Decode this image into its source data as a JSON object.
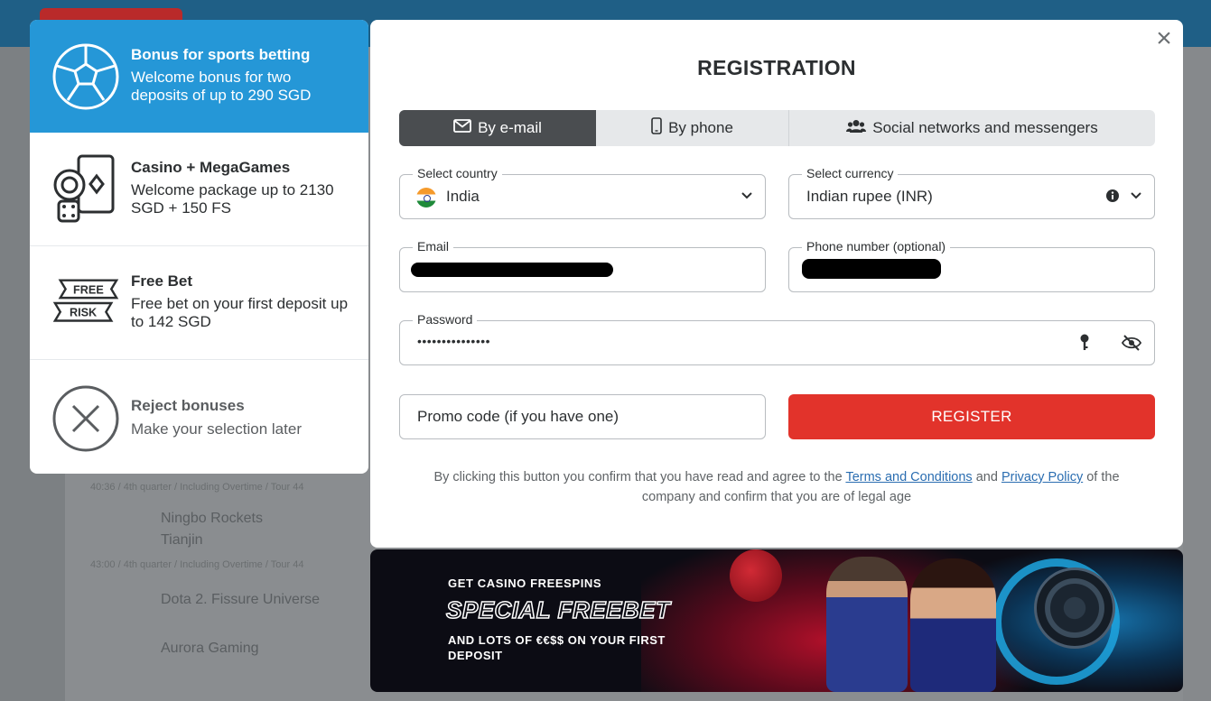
{
  "modal": {
    "title": "REGISTRATION",
    "close_label": "×"
  },
  "tabs": [
    {
      "label": "By e-mail",
      "icon": "envelope-icon",
      "active": true
    },
    {
      "label": "By phone",
      "icon": "phone-icon",
      "active": false
    },
    {
      "label": "Social networks and messengers",
      "icon": "users-icon",
      "active": false
    }
  ],
  "form": {
    "country": {
      "label": "Select country",
      "value": "India",
      "icon": "india-flag-icon"
    },
    "currency": {
      "label": "Select currency",
      "value": "Indian rupee (INR)"
    },
    "email": {
      "label": "Email"
    },
    "phone": {
      "label": "Phone number (optional)"
    },
    "password": {
      "label": "Password",
      "value": "•••••••••••••••"
    },
    "promo": {
      "placeholder": "Promo code (if you have one)"
    },
    "register_label": "REGISTER"
  },
  "legal": {
    "prefix": "By clicking this button you confirm that you have read and agree to the",
    "terms": "Terms and Conditions",
    "and": "and",
    "privacy": "Privacy Policy",
    "suffix": "of the company and confirm that you are of legal age"
  },
  "bonuses": [
    {
      "title": "Bonus for sports betting",
      "desc": "Welcome bonus for two deposits of up to 290 SGD",
      "icon": "soccer-ball-icon",
      "active": true
    },
    {
      "title": "Casino + MegaGames",
      "desc": "Welcome package up to 2130 SGD + 150 FS",
      "icon": "casino-cards-icon",
      "active": false
    },
    {
      "title": "Free Bet",
      "desc": "Free bet on your first deposit up to 142 SGD",
      "icon": "free-risk-icon",
      "active": false,
      "icon_text_top": "FREE",
      "icon_text_bottom": "RISK"
    },
    {
      "title": "Reject bonuses",
      "desc": "Make your selection later",
      "icon": "reject-icon",
      "active": false
    }
  ],
  "banner": {
    "line1": "GET CASINO FREESPINS",
    "line2": "SPECIAL FREEBET",
    "line3": "AND LOTS OF €€$$ ON YOUR FIRST DEPOSIT"
  },
  "background": {
    "rows": [
      {
        "team1": "Ningbo Rockets",
        "team2": "Tianjin",
        "sub": "43:00 / 4th quarter / Including Overtime / Tour 44"
      },
      {
        "team1": "Dota 2. Fissure Universe",
        "team2": "",
        "sub": ""
      },
      {
        "team1": "Aurora Gaming",
        "team2": "",
        "sub": ""
      }
    ],
    "top_sub": "40:36 / 4th quarter / Including Overtime / Tour 44"
  },
  "colors": {
    "accent_blue": "#2597d7",
    "register_red": "#e2332b",
    "active_tab": "#4a4d50",
    "link": "#2a6db1"
  }
}
